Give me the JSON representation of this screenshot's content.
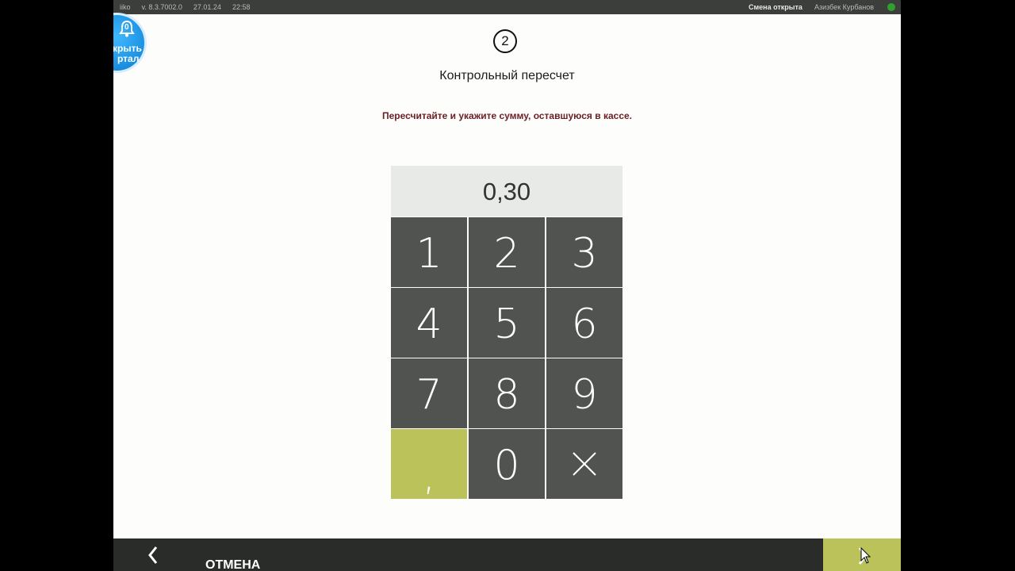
{
  "topbar": {
    "app": "iiko",
    "version": "v. 8.3.7002.0",
    "date": "27.01.24",
    "time": "22:58",
    "shift_status": "Смена открыта",
    "user": "Азизбек Курбанов",
    "status_color": "#2fa12f"
  },
  "portal": {
    "count": "0",
    "line1": "крыть",
    "line2": "ртал"
  },
  "step": {
    "number": "2"
  },
  "page": {
    "title": "Контрольный пересчет",
    "instruction": "Пересчитайте и укажите сумму, оставшуюся в кассе."
  },
  "keypad": {
    "display_value": "0,30",
    "keys": [
      "1",
      "2",
      "3",
      "4",
      "5",
      "6",
      "7",
      "8",
      "9",
      ",",
      "0"
    ],
    "clear_icon": "close-x-icon",
    "accent_color": "#bcc25a",
    "key_color": "#505350"
  },
  "bottom": {
    "back_icon": "chevron-left-icon",
    "cancel_label": "ОТМЕНА",
    "next_icon": "chevron-right-icon"
  }
}
